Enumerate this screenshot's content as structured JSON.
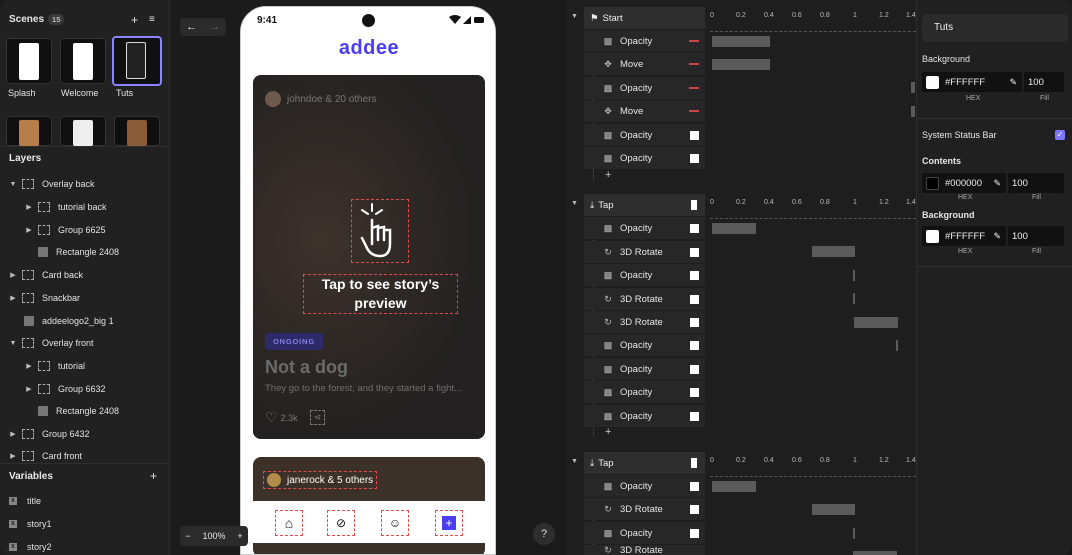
{
  "scenes": {
    "title": "Scenes",
    "count": "15",
    "items": [
      {
        "label": "Splash"
      },
      {
        "label": "Welcome"
      },
      {
        "label": "Tuts"
      }
    ]
  },
  "layers": {
    "title": "Layers",
    "items": [
      {
        "label": "Overlay back"
      },
      {
        "label": "tutorial back"
      },
      {
        "label": "Group 6625"
      },
      {
        "label": "Rectangle 2408"
      },
      {
        "label": "Card back"
      },
      {
        "label": "Snackbar"
      },
      {
        "label": "addeelogo2_big 1"
      },
      {
        "label": "Overlay front"
      },
      {
        "label": "tutorial"
      },
      {
        "label": "Group 6632"
      },
      {
        "label": "Rectangle 2408"
      },
      {
        "label": "Group 6432"
      },
      {
        "label": "Card front"
      }
    ]
  },
  "variables": {
    "title": "Variables",
    "items": [
      {
        "label": "title"
      },
      {
        "label": "story1"
      },
      {
        "label": "story2"
      }
    ]
  },
  "phone": {
    "time": "9:41",
    "logo": "addee",
    "card1": {
      "user": "johndoe & 20 others",
      "tap_text": "Tap to see story’s preview",
      "pill": "ONGOING",
      "title": "Not a dog",
      "desc": "They go to the forest, and they started a fight...",
      "likes": "2.3k"
    },
    "card2": {
      "user": "janerock & 5 others"
    }
  },
  "canvas": {
    "zoom": "100%",
    "help": "?"
  },
  "timeline": {
    "ruler": [
      "0",
      "0.2",
      "0.4",
      "0.6",
      "0.8",
      "1",
      "1.2",
      "1.4"
    ],
    "groups": [
      {
        "name": "Start",
        "rows": [
          {
            "label": "Opacity"
          },
          {
            "label": "Move"
          },
          {
            "label": "Opacity"
          },
          {
            "label": "Move"
          },
          {
            "label": "Opacity"
          },
          {
            "label": "Opacity"
          }
        ]
      },
      {
        "name": "Tap",
        "rows": [
          {
            "label": "Opacity"
          },
          {
            "label": "3D Rotate"
          },
          {
            "label": "Opacity"
          },
          {
            "label": "3D Rotate"
          },
          {
            "label": "3D Rotate"
          },
          {
            "label": "Opacity"
          },
          {
            "label": "Opacity"
          },
          {
            "label": "Opacity"
          },
          {
            "label": "Opacity"
          }
        ]
      },
      {
        "name": "Tap",
        "rows": [
          {
            "label": "Opacity"
          },
          {
            "label": "3D Rotate"
          },
          {
            "label": "Opacity"
          },
          {
            "label": "3D Rotate"
          }
        ]
      }
    ]
  },
  "inspector": {
    "title": "Tuts",
    "background_label": "Background",
    "background": {
      "hex": "#FFFFFF",
      "fill": "100",
      "hex_label": "HEX",
      "fill_label": "Fill"
    },
    "status_bar_label": "System Status Bar",
    "contents_label": "Contents",
    "contents": {
      "hex": "#000000",
      "fill": "100",
      "hex_label": "HEX",
      "fill_label": "Fill"
    },
    "background2_label": "Background",
    "background2": {
      "hex": "#FFFFFF",
      "fill": "100",
      "hex_label": "HEX",
      "fill_label": "Fill"
    }
  },
  "colors": {
    "accent": "#7d76ff",
    "brand": "#4a3df2"
  }
}
